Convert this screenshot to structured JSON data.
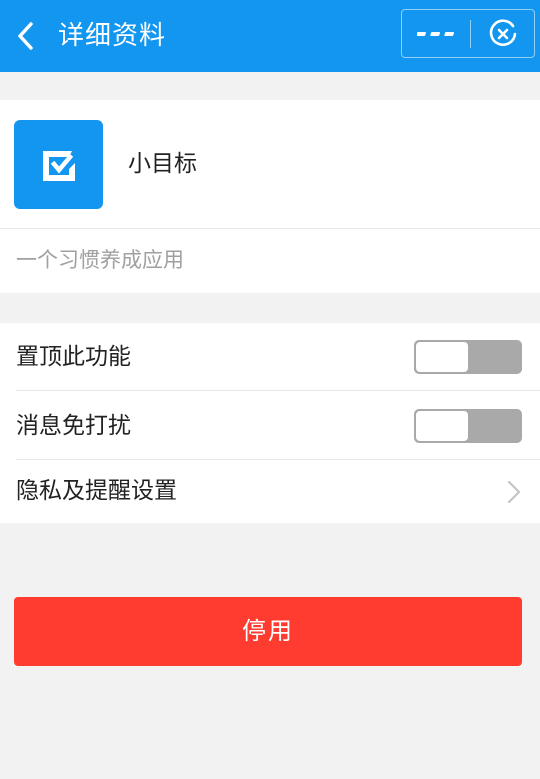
{
  "header": {
    "title": "详细资料",
    "back_icon": "chevron-left-icon",
    "more_icon": "more-dots-icon",
    "close_icon": "close-circle-icon"
  },
  "app": {
    "name": "小目标",
    "description": "一个习惯养成应用",
    "icon": "checkbox-icon"
  },
  "settings": {
    "items": [
      {
        "label": "置顶此功能",
        "type": "toggle",
        "on": false
      },
      {
        "label": "消息免打扰",
        "type": "toggle",
        "on": false
      },
      {
        "label": "隐私及提醒设置",
        "type": "link"
      }
    ]
  },
  "actions": {
    "disable_label": "停用"
  },
  "colors": {
    "header": "#1296f0",
    "app_icon": "#1296f0",
    "danger": "#ff3c2f",
    "toggle_off": "#a9a9a9"
  }
}
